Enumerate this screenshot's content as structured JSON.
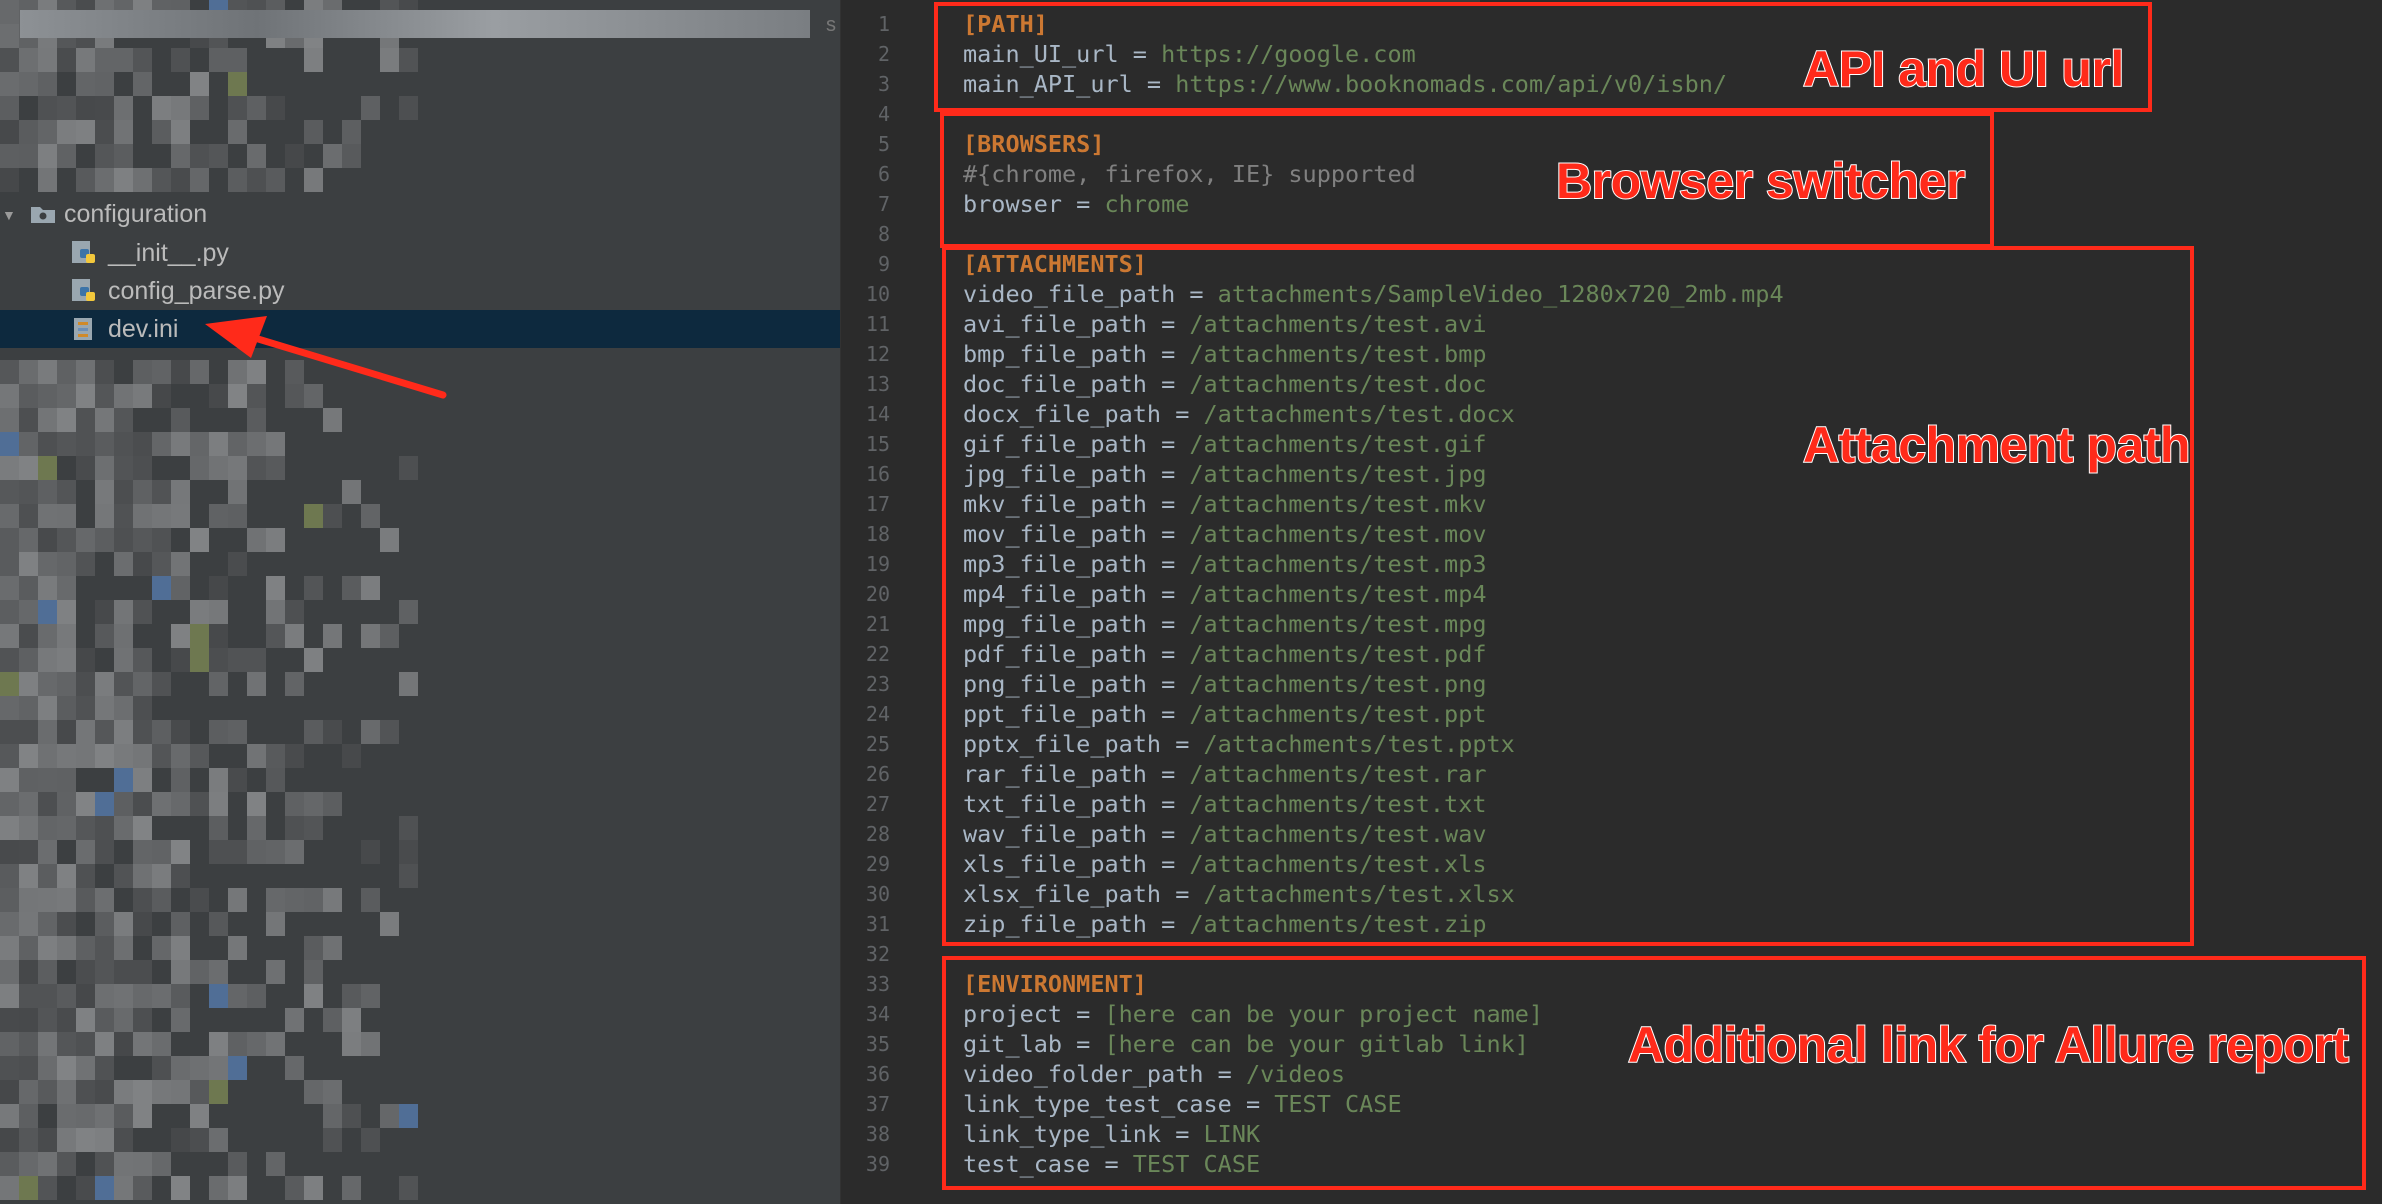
{
  "sidebar": {
    "folder_label": "configuration",
    "files": [
      "__init__.py",
      "config_parse.py",
      "dev.ini"
    ],
    "selected_file": "dev.ini",
    "truncated_char": "s"
  },
  "editor": {
    "lines": [
      {
        "n": "1",
        "parts": [
          [
            "s",
            "[PATH]"
          ]
        ]
      },
      {
        "n": "2",
        "parts": [
          [
            "k",
            "main_UI_url = "
          ],
          [
            "v",
            "https://google.com"
          ]
        ]
      },
      {
        "n": "3",
        "parts": [
          [
            "k",
            "main_API_url = "
          ],
          [
            "v",
            "https://www.booknomads.com/api/v0/isbn/"
          ]
        ]
      },
      {
        "n": "4",
        "parts": []
      },
      {
        "n": "5",
        "parts": [
          [
            "s",
            "[BROWSERS]"
          ]
        ]
      },
      {
        "n": "6",
        "parts": [
          [
            "c",
            "#{chrome, firefox, IE} supported"
          ]
        ]
      },
      {
        "n": "7",
        "parts": [
          [
            "k",
            "browser = "
          ],
          [
            "v",
            "chrome"
          ]
        ]
      },
      {
        "n": "8",
        "parts": []
      },
      {
        "n": "9",
        "parts": [
          [
            "s",
            "[ATTACHMENTS]"
          ]
        ]
      },
      {
        "n": "10",
        "parts": [
          [
            "k",
            "video_file_path = "
          ],
          [
            "v",
            "attachments/SampleVideo_1280x720_2mb.mp4"
          ]
        ]
      },
      {
        "n": "11",
        "parts": [
          [
            "k",
            "avi_file_path = "
          ],
          [
            "v",
            "/attachments/test.avi"
          ]
        ]
      },
      {
        "n": "12",
        "parts": [
          [
            "k",
            "bmp_file_path = "
          ],
          [
            "v",
            "/attachments/test.bmp"
          ]
        ]
      },
      {
        "n": "13",
        "parts": [
          [
            "k",
            "doc_file_path = "
          ],
          [
            "v",
            "/attachments/test.doc"
          ]
        ]
      },
      {
        "n": "14",
        "parts": [
          [
            "k",
            "docx_file_path = "
          ],
          [
            "v",
            "/attachments/test.docx"
          ]
        ]
      },
      {
        "n": "15",
        "parts": [
          [
            "k",
            "gif_file_path = "
          ],
          [
            "v",
            "/attachments/test.gif"
          ]
        ]
      },
      {
        "n": "16",
        "parts": [
          [
            "k",
            "jpg_file_path = "
          ],
          [
            "v",
            "/attachments/test.jpg"
          ]
        ]
      },
      {
        "n": "17",
        "parts": [
          [
            "k",
            "mkv_file_path = "
          ],
          [
            "v",
            "/attachments/test.mkv"
          ]
        ]
      },
      {
        "n": "18",
        "parts": [
          [
            "k",
            "mov_file_path = "
          ],
          [
            "v",
            "/attachments/test.mov"
          ]
        ]
      },
      {
        "n": "19",
        "parts": [
          [
            "k",
            "mp3_file_path = "
          ],
          [
            "v",
            "/attachments/test.mp3"
          ]
        ]
      },
      {
        "n": "20",
        "parts": [
          [
            "k",
            "mp4_file_path = "
          ],
          [
            "v",
            "/attachments/test.mp4"
          ]
        ]
      },
      {
        "n": "21",
        "parts": [
          [
            "k",
            "mpg_file_path = "
          ],
          [
            "v",
            "/attachments/test.mpg"
          ]
        ]
      },
      {
        "n": "22",
        "parts": [
          [
            "k",
            "pdf_file_path = "
          ],
          [
            "v",
            "/attachments/test.pdf"
          ]
        ]
      },
      {
        "n": "23",
        "parts": [
          [
            "k",
            "png_file_path = "
          ],
          [
            "v",
            "/attachments/test.png"
          ]
        ]
      },
      {
        "n": "24",
        "parts": [
          [
            "k",
            "ppt_file_path = "
          ],
          [
            "v",
            "/attachments/test.ppt"
          ]
        ]
      },
      {
        "n": "25",
        "parts": [
          [
            "k",
            "pptx_file_path = "
          ],
          [
            "v",
            "/attachments/test.pptx"
          ]
        ]
      },
      {
        "n": "26",
        "parts": [
          [
            "k",
            "rar_file_path = "
          ],
          [
            "v",
            "/attachments/test.rar"
          ]
        ]
      },
      {
        "n": "27",
        "parts": [
          [
            "k",
            "txt_file_path = "
          ],
          [
            "v",
            "/attachments/test.txt"
          ]
        ]
      },
      {
        "n": "28",
        "parts": [
          [
            "k",
            "wav_file_path = "
          ],
          [
            "v",
            "/attachments/test.wav"
          ]
        ]
      },
      {
        "n": "29",
        "parts": [
          [
            "k",
            "xls_file_path = "
          ],
          [
            "v",
            "/attachments/test.xls"
          ]
        ]
      },
      {
        "n": "30",
        "parts": [
          [
            "k",
            "xlsx_file_path = "
          ],
          [
            "v",
            "/attachments/test.xlsx"
          ]
        ]
      },
      {
        "n": "31",
        "parts": [
          [
            "k",
            "zip_file_path = "
          ],
          [
            "v",
            "/attachments/test.zip"
          ]
        ]
      },
      {
        "n": "32",
        "parts": []
      },
      {
        "n": "33",
        "parts": [
          [
            "s",
            "[ENVIRONMENT]"
          ]
        ]
      },
      {
        "n": "34",
        "parts": [
          [
            "k",
            "project = "
          ],
          [
            "v",
            "[here can be your project name]"
          ]
        ]
      },
      {
        "n": "35",
        "parts": [
          [
            "k",
            "git_lab = "
          ],
          [
            "v",
            "[here can be your gitlab link]"
          ]
        ]
      },
      {
        "n": "36",
        "parts": [
          [
            "k",
            "video_folder_path = "
          ],
          [
            "v",
            "/videos"
          ]
        ]
      },
      {
        "n": "37",
        "parts": [
          [
            "k",
            "link_type_test_case = "
          ],
          [
            "v",
            "TEST CASE"
          ]
        ]
      },
      {
        "n": "38",
        "parts": [
          [
            "k",
            "link_type_link = "
          ],
          [
            "v",
            "LINK"
          ]
        ]
      },
      {
        "n": "39",
        "parts": [
          [
            "k",
            "test_case = "
          ],
          [
            "v",
            "TEST CASE"
          ]
        ]
      }
    ]
  },
  "annotations": {
    "path_label": "API and UI url",
    "browsers_label": "Browser switcher",
    "attachments_label": "Attachment path",
    "environment_label": "Additional link for Allure report"
  },
  "colors": {
    "accent_red": "#ff2a1a",
    "section": "#cc7832",
    "value": "#6a8759",
    "key": "#a9b7c6",
    "comment": "#808080",
    "selection": "#0d293e"
  }
}
